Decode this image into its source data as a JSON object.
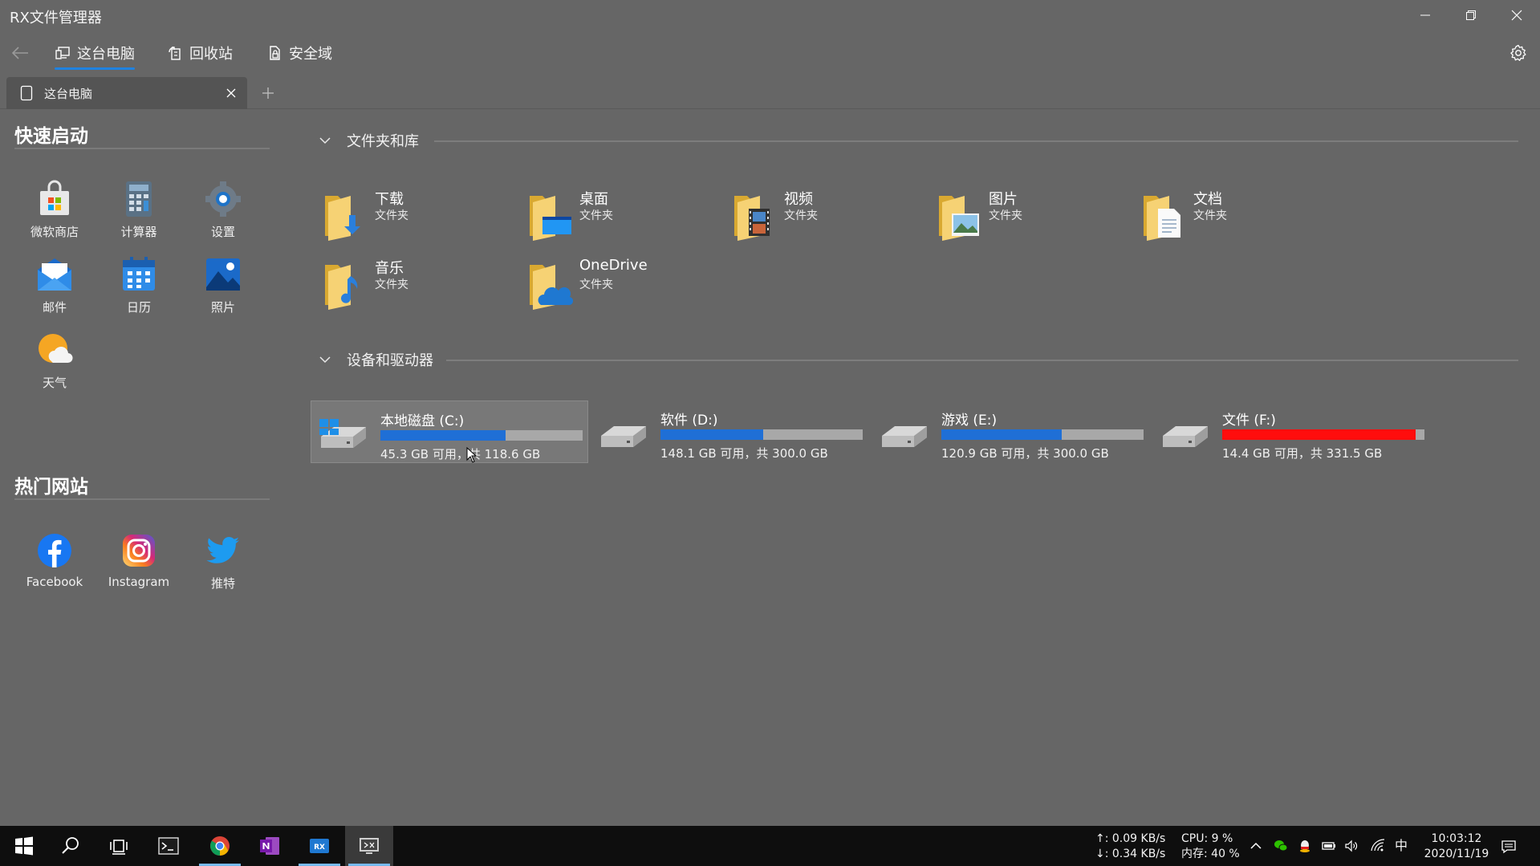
{
  "window": {
    "title": "RX文件管理器"
  },
  "nav": {
    "items": [
      {
        "label": "这台电脑",
        "icon": "this-pc-icon"
      },
      {
        "label": "回收站",
        "icon": "recycle-bin-icon"
      },
      {
        "label": "安全域",
        "icon": "secure-area-icon"
      }
    ]
  },
  "tabs": [
    {
      "label": "这台电脑"
    }
  ],
  "sidebar": {
    "quick_start": {
      "heading": "快速启动",
      "apps": [
        {
          "label": "微软商店",
          "icon": "store-icon"
        },
        {
          "label": "计算器",
          "icon": "calculator-icon"
        },
        {
          "label": "设置",
          "icon": "settings-icon"
        },
        {
          "label": "邮件",
          "icon": "mail-icon"
        },
        {
          "label": "日历",
          "icon": "calendar-icon"
        },
        {
          "label": "照片",
          "icon": "photos-icon"
        },
        {
          "label": "天气",
          "icon": "weather-icon"
        }
      ]
    },
    "hot_sites": {
      "heading": "热门网站",
      "sites": [
        {
          "label": "Facebook",
          "icon": "facebook-icon"
        },
        {
          "label": "Instagram",
          "icon": "instagram-icon"
        },
        {
          "label": "推特",
          "icon": "twitter-icon"
        }
      ]
    }
  },
  "main": {
    "folders_section": {
      "title": "文件夹和库",
      "items": [
        {
          "name": "下载",
          "type": "文件夹",
          "icon": "downloads-folder-icon"
        },
        {
          "name": "桌面",
          "type": "文件夹",
          "icon": "desktop-folder-icon"
        },
        {
          "name": "视频",
          "type": "文件夹",
          "icon": "videos-folder-icon"
        },
        {
          "name": "图片",
          "type": "文件夹",
          "icon": "pictures-folder-icon"
        },
        {
          "name": "文档",
          "type": "文件夹",
          "icon": "documents-folder-icon"
        },
        {
          "name": "音乐",
          "type": "文件夹",
          "icon": "music-folder-icon"
        },
        {
          "name": "OneDrive",
          "type": "文件夹",
          "icon": "onedrive-folder-icon"
        }
      ]
    },
    "drives_section": {
      "title": "设备和驱动器",
      "items": [
        {
          "name": "本地磁盘 (C:)",
          "free_text": "45.3 GB 可用，共 118.6 GB",
          "used_fraction": 0.618,
          "selected": true
        },
        {
          "name": "软件 (D:)",
          "free_text": "148.1 GB 可用，共 300.0 GB",
          "used_fraction": 0.506
        },
        {
          "name": "游戏 (E:)",
          "free_text": "120.9 GB 可用，共 300.0 GB",
          "used_fraction": 0.597
        },
        {
          "name": "文件 (F:)",
          "free_text": "14.4 GB 可用，共 331.5 GB",
          "used_fraction": 0.957,
          "warning": true
        }
      ]
    }
  },
  "taskbar": {
    "net_up": "↑: 0.09 KB/s",
    "net_down": "↓: 0.34 KB/s",
    "cpu": "CPU: 9 %",
    "memory": "内存: 40 %",
    "ime": "中",
    "time": "10:03:12",
    "date": "2020/11/19"
  },
  "colors": {
    "background": "#666666",
    "accent": "#1f82e0",
    "drive_bar_fill": "#1f6fd6",
    "drive_bar_warning": "#ff0d0d",
    "drive_bar_track": "#a8a8a8",
    "taskbar": "#0e0e0e"
  }
}
